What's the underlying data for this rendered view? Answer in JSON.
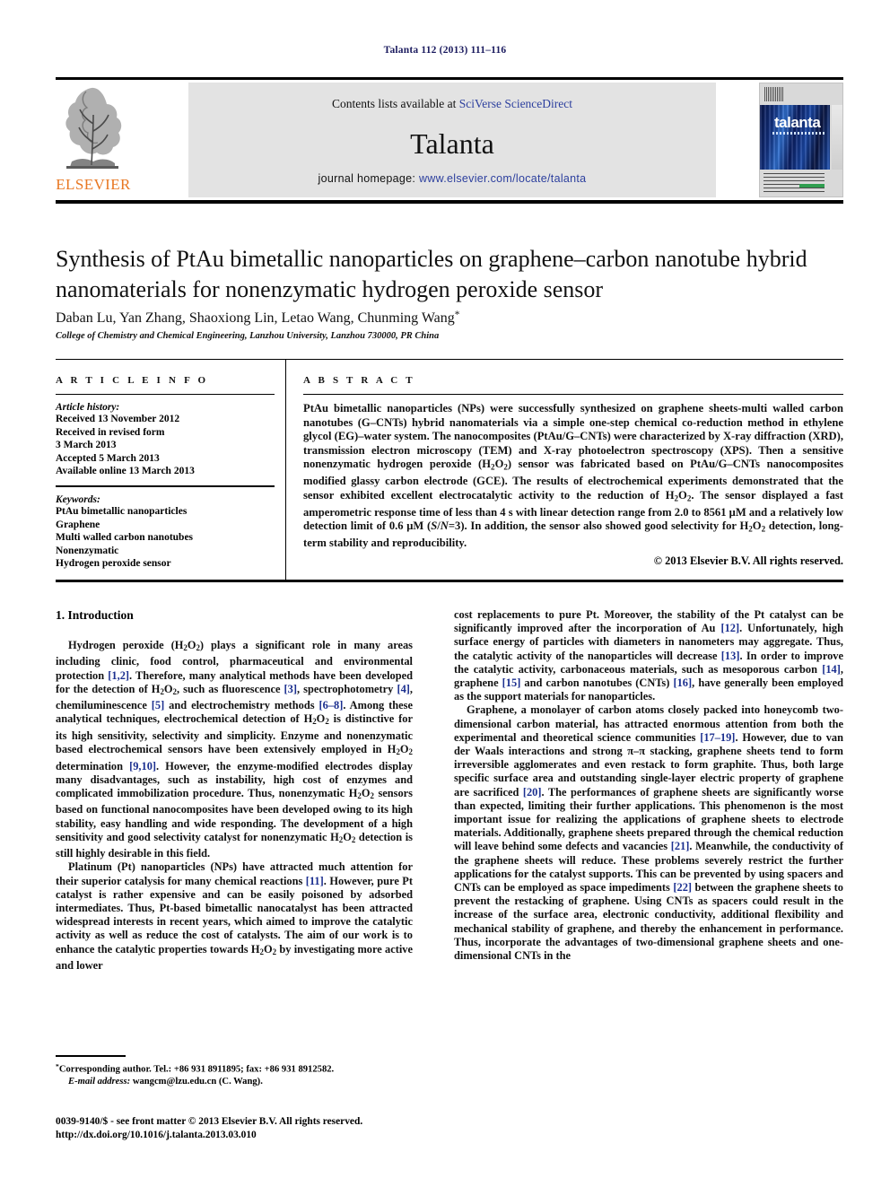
{
  "running_head": "Talanta 112 (2013) 111–116",
  "banner": {
    "publisher_name": "ELSEVIER",
    "contents_prefix": "Contents lists available at ",
    "contents_link": "SciVerse ScienceDirect",
    "journal_name": "Talanta",
    "homepage_prefix": "journal homepage: ",
    "homepage_link": "www.elsevier.com/locate/talanta",
    "cover_title": "talanta"
  },
  "article": {
    "title": "Synthesis of PtAu bimetallic nanoparticles on graphene–carbon nanotube hybrid nanomaterials for nonenzymatic hydrogen peroxide sensor",
    "authors": "Daban Lu, Yan Zhang, Shaoxiong Lin, Letao Wang, Chunming Wang",
    "author_marker": "*",
    "affiliation": "College of Chemistry and Chemical Engineering, Lanzhou University, Lanzhou 730000, PR China"
  },
  "article_info": {
    "heading": "A R T I C L E   I N F O",
    "history_label": "Article history:",
    "history": [
      "Received 13 November 2012",
      "Received in revised form",
      "3 March 2013",
      "Accepted 5 March 2013",
      "Available online 13 March 2013"
    ],
    "keywords_label": "Keywords:",
    "keywords": [
      "PtAu bimetallic nanoparticles",
      "Graphene",
      "Multi walled carbon nanotubes",
      "Nonenzymatic",
      "Hydrogen peroxide sensor"
    ]
  },
  "abstract": {
    "heading": "A B S T R A C T",
    "text": "PtAu bimetallic nanoparticles (NPs) were successfully synthesized on graphene sheets-multi walled carbon nanotubes (G–CNTs) hybrid nanomaterials via a simple one-step chemical co-reduction method in ethylene glycol (EG)–water system. The nanocomposites (PtAu/G–CNTs) were characterized by X-ray diffraction (XRD), transmission electron microscopy (TEM) and X-ray photoelectron spectroscopy (XPS). Then a sensitive nonenzymatic hydrogen peroxide (H2O2) sensor was fabricated based on PtAu/G–CNTs nanocomposites modified glassy carbon electrode (GCE). The results of electrochemical experiments demonstrated that the sensor exhibited excellent electrocatalytic activity to the reduction of H2O2. The sensor displayed a fast amperometric response time of less than 4 s with linear detection range from 2.0 to 8561 μM and a relatively low detection limit of 0.6 μM (S/N=3). In addition, the sensor also showed good selectivity for H2O2 detection, long-term stability and reproducibility.",
    "copyright": "© 2013 Elsevier B.V. All rights reserved."
  },
  "introduction": {
    "heading": "1.  Introduction",
    "left_paragraphs": [
      "Hydrogen peroxide (H2O2) plays a significant role in many areas including clinic, food control, pharmaceutical and environmental protection [1,2]. Therefore, many analytical methods have been developed for the detection of H2O2, such as fluorescence [3], spectrophotometry [4], chemiluminescence [5] and electrochemistry methods [6–8]. Among these analytical techniques, electrochemical detection of H2O2 is distinctive for its high sensitivity, selectivity and simplicity. Enzyme and nonenzymatic based electrochemical sensors have been extensively employed in H2O2 determination [9,10]. However, the enzyme-modified electrodes display many disadvantages, such as instability, high cost of enzymes and complicated immobilization procedure. Thus, nonenzymatic H2O2 sensors based on functional nanocomposites have been developed owing to its high stability, easy handling and wide responding. The development of a high sensitivity and good selectivity catalyst for nonenzymatic H2O2 detection is still highly desirable in this field.",
      "Platinum (Pt) nanoparticles (NPs) have attracted much attention for their superior catalysis for many chemical reactions [11]. However, pure Pt catalyst is rather expensive and can be easily poisoned by adsorbed intermediates. Thus, Pt-based bimetallic nanocatalyst has been attracted widespread interests in recent years, which aimed to improve the catalytic activity as well as reduce the cost of catalysts. The aim of our work is to enhance the catalytic properties towards H2O2 by investigating more active and lower"
    ],
    "right_paragraphs": [
      "cost replacements to pure Pt. Moreover, the stability of the Pt catalyst can be significantly improved after the incorporation of Au [12]. Unfortunately, high surface energy of particles with diameters in nanometers may aggregate. Thus, the catalytic activity of the nanoparticles will decrease [13]. In order to improve the catalytic activity, carbonaceous materials, such as mesoporous carbon [14], graphene [15] and carbon nanotubes (CNTs) [16], have generally been employed as the support materials for nanoparticles.",
      "Graphene, a monolayer of carbon atoms closely packed into honeycomb two-dimensional carbon material, has attracted enormous attention from both the experimental and theoretical science communities [17–19]. However, due to van der Waals interactions and strong π–π stacking, graphene sheets tend to form irreversible agglomerates and even restack to form graphite. Thus, both large specific surface area and outstanding single-layer electric property of graphene are sacrificed [20]. The performances of graphene sheets are significantly worse than expected, limiting their further applications. This phenomenon is the most important issue for realizing the applications of graphene sheets to electrode materials. Additionally, graphene sheets prepared through the chemical reduction will leave behind some defects and vacancies [21]. Meanwhile, the conductivity of the graphene sheets will reduce. These problems severely restrict the further applications for the catalyst supports. This can be prevented by using spacers and CNTs can be employed as space impediments [22] between the graphene sheets to prevent the restacking of graphene. Using CNTs as spacers could result in the increase of the surface area, electronic conductivity, additional flexibility and mechanical stability of graphene, and thereby the enhancement in performance. Thus, incorporate the advantages of two-dimensional graphene sheets and one-dimensional CNTs in the"
    ]
  },
  "footnote": {
    "marker": "*",
    "corresponding": "Corresponding author. Tel.: +86 931 8911895; fax: +86 931 8912582.",
    "email_label": "E-mail address:",
    "email": "wangcm@lzu.edu.cn (C. Wang)."
  },
  "imprint": {
    "line1": "0039-9140/$ - see front matter © 2013 Elsevier B.V. All rights reserved.",
    "line2": "http://dx.doi.org/10.1016/j.talanta.2013.03.010"
  },
  "colors": {
    "link": "#2c3f9e",
    "citation": "#1b2f8f",
    "elsevier_orange": "#E87722",
    "running_head": "#1a1a5e"
  }
}
